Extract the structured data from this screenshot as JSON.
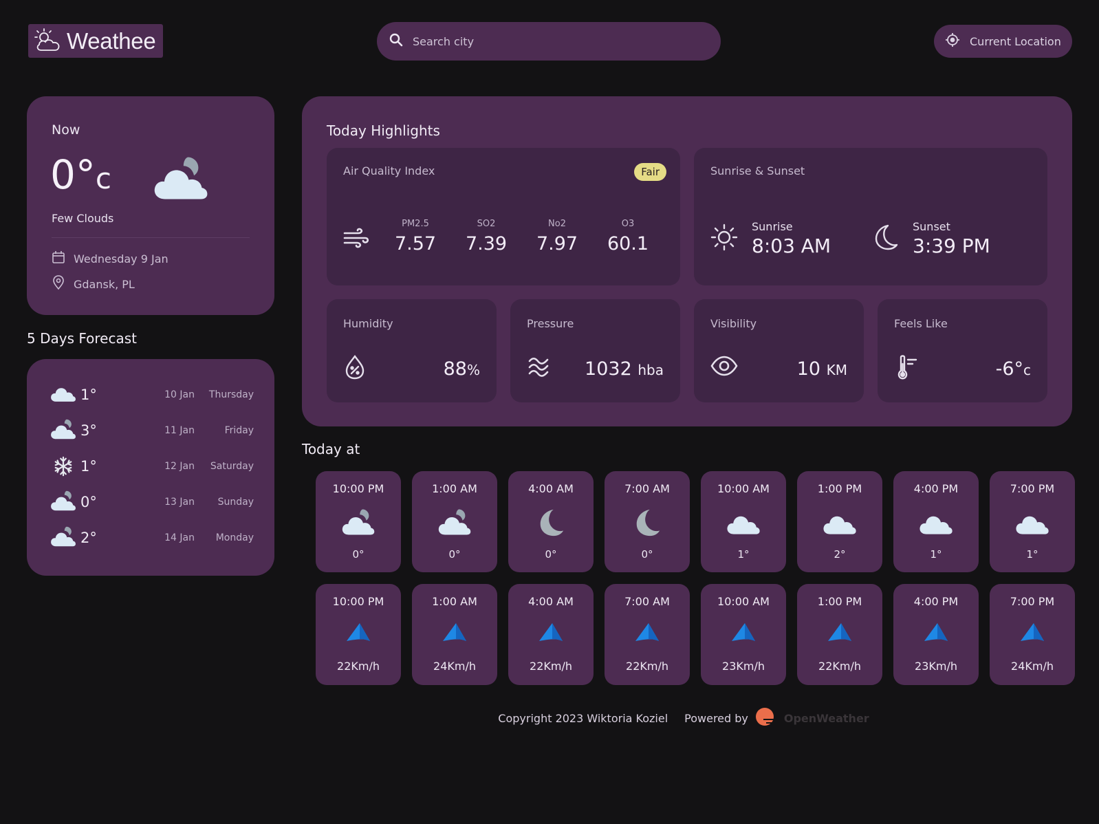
{
  "header": {
    "logo_text": "Weathee",
    "search_placeholder": "Search city",
    "current_location_label": "Current Location"
  },
  "now": {
    "label": "Now",
    "temp": "0°",
    "temp_unit": "c",
    "condition": "Few Clouds",
    "date": "Wednesday 9 Jan",
    "location": "Gdansk, PL"
  },
  "forecast": {
    "title": "5 Days Forecast",
    "items": [
      {
        "temp": "1°",
        "date": "10 Jan",
        "day": "Thursday",
        "icon": "cloud-icon"
      },
      {
        "temp": "3°",
        "date": "11 Jan",
        "day": "Friday",
        "icon": "cloud-moon-icon"
      },
      {
        "temp": "1°",
        "date": "12 Jan",
        "day": "Saturday",
        "icon": "snowflake-icon"
      },
      {
        "temp": "0°",
        "date": "13 Jan",
        "day": "Sunday",
        "icon": "cloud-moon-icon"
      },
      {
        "temp": "2°",
        "date": "14 Jan",
        "day": "Monday",
        "icon": "cloud-moon-icon"
      }
    ]
  },
  "highlights": {
    "title": "Today Highlights",
    "air_quality": {
      "label": "Air Quality Index",
      "badge": "Fair",
      "items": [
        {
          "key": "PM2.5",
          "value": "7.57"
        },
        {
          "key": "SO2",
          "value": "7.39"
        },
        {
          "key": "No2",
          "value": "7.97"
        },
        {
          "key": "O3",
          "value": "60.1"
        }
      ]
    },
    "sun": {
      "label": "Sunrise & Sunset",
      "sunrise_label": "Sunrise",
      "sunrise": "8:03 AM",
      "sunset_label": "Sunset",
      "sunset": "3:39 PM"
    },
    "humidity": {
      "label": "Humidity",
      "value": "88",
      "unit": "%"
    },
    "pressure": {
      "label": "Pressure",
      "value": "1032",
      "unit": "hba"
    },
    "visibility": {
      "label": "Visibility",
      "value": "10",
      "unit": "KM"
    },
    "feels_like": {
      "label": "Feels Like",
      "value": "-6°",
      "unit": "c"
    }
  },
  "today": {
    "title": "Today at",
    "hours": [
      {
        "time": "10:00 PM",
        "temp": "0°",
        "icon": "cloud-moon-icon"
      },
      {
        "time": "1:00 AM",
        "temp": "0°",
        "icon": "cloud-moon-icon"
      },
      {
        "time": "4:00 AM",
        "temp": "0°",
        "icon": "moon-icon"
      },
      {
        "time": "7:00 AM",
        "temp": "0°",
        "icon": "moon-icon"
      },
      {
        "time": "10:00 AM",
        "temp": "1°",
        "icon": "cloud-icon"
      },
      {
        "time": "1:00 PM",
        "temp": "2°",
        "icon": "cloud-icon"
      },
      {
        "time": "4:00 PM",
        "temp": "1°",
        "icon": "cloud-icon"
      },
      {
        "time": "7:00 PM",
        "temp": "1°",
        "icon": "cloud-icon"
      }
    ],
    "wind": [
      {
        "time": "10:00 PM",
        "speed": "22Km/h"
      },
      {
        "time": "1:00 AM",
        "speed": "24Km/h"
      },
      {
        "time": "4:00 AM",
        "speed": "22Km/h"
      },
      {
        "time": "7:00 AM",
        "speed": "22Km/h"
      },
      {
        "time": "10:00 AM",
        "speed": "23Km/h"
      },
      {
        "time": "1:00 PM",
        "speed": "22Km/h"
      },
      {
        "time": "4:00 PM",
        "speed": "23Km/h"
      },
      {
        "time": "7:00 PM",
        "speed": "24Km/h"
      }
    ]
  },
  "footer": {
    "copyright": "Copyright 2023 Wiktoria Koziel",
    "powered_by": "Powered by",
    "brand": "OpenWeather"
  },
  "colors": {
    "background": "#131214",
    "card": "#4d2c52",
    "badge": "#e5dc86",
    "wind_arrow": "#1e88e5"
  }
}
